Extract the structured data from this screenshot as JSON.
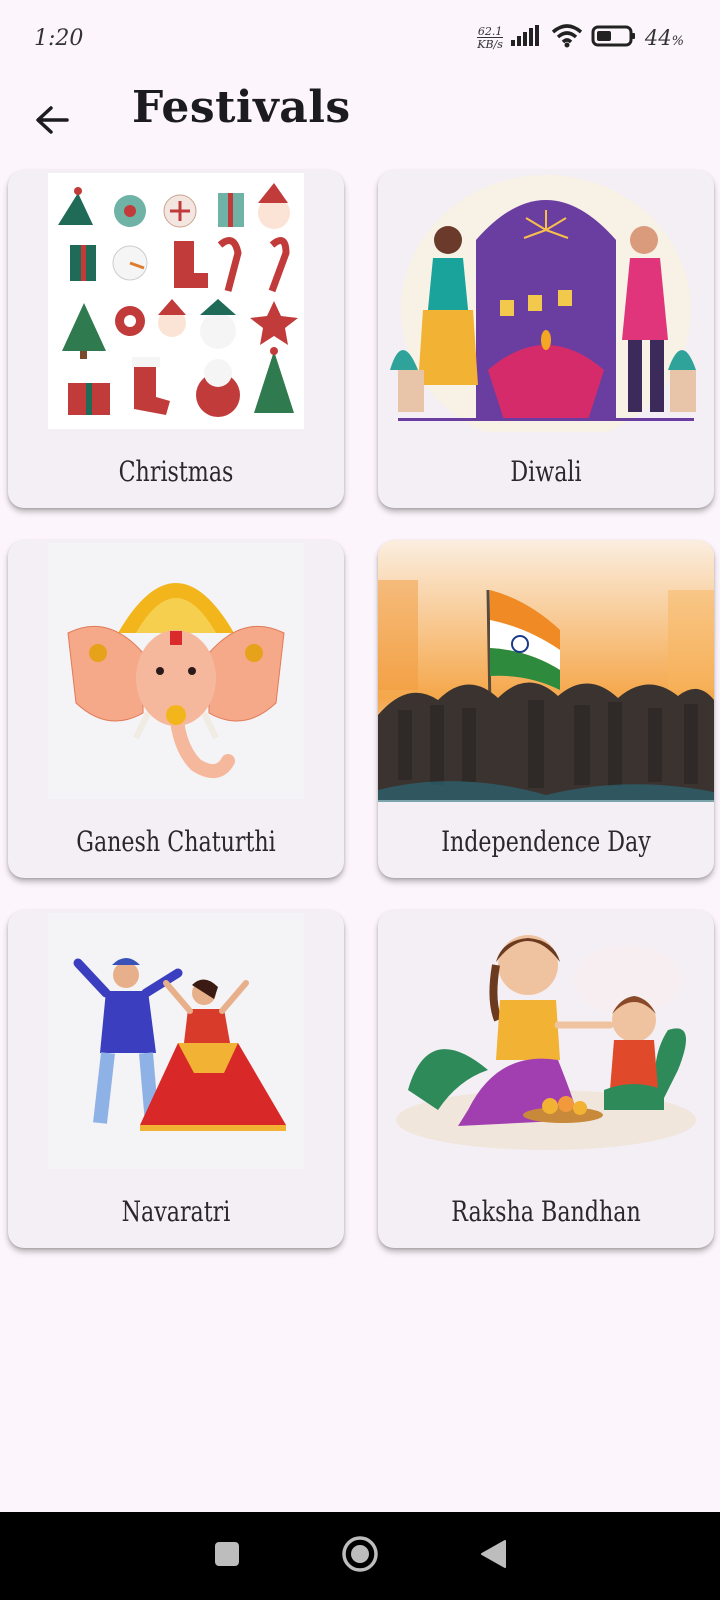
{
  "status_bar": {
    "time": "1:20",
    "net_speed_value": "62.1",
    "net_speed_unit": "KB/s",
    "battery_percent": "44",
    "battery_symbol": "%"
  },
  "app_bar": {
    "title": "Festivals",
    "back_icon": "arrow-left-icon"
  },
  "festivals": [
    {
      "label": "Christmas",
      "image": "christmas-ornaments-illustration"
    },
    {
      "label": "Diwali",
      "image": "diwali-couple-lamps-illustration"
    },
    {
      "label": "Ganesh Chaturthi",
      "image": "ganesha-head-illustration"
    },
    {
      "label": "Independence Day",
      "image": "indian-flag-crowd-illustration"
    },
    {
      "label": "Navaratri",
      "image": "garba-dancers-illustration"
    },
    {
      "label": "Raksha Bandhan",
      "image": "rakhi-siblings-illustration"
    }
  ],
  "nav_bar": {
    "recents_icon": "square-icon",
    "home_icon": "circle-icon",
    "back_icon": "triangle-back-icon"
  },
  "colors": {
    "background": "#fcf5fb",
    "card": "#f3eff5",
    "text": "#1c1b1f"
  }
}
